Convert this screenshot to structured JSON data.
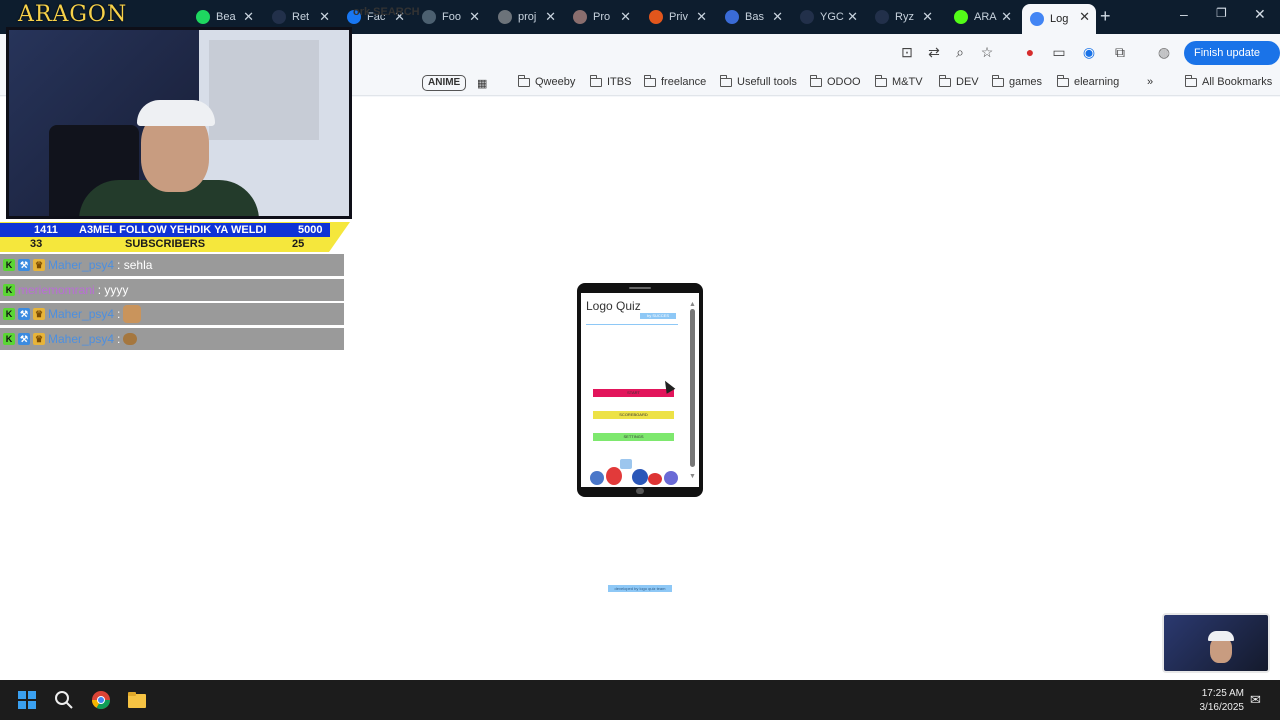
{
  "tabs": [
    {
      "label": "Bea",
      "icon": "spotify-icon",
      "color": "#1ed760"
    },
    {
      "label": "Ret",
      "icon": "page-icon",
      "color": "#22304a"
    },
    {
      "label": "Fac",
      "icon": "facebook-icon",
      "color": "#1877f2"
    },
    {
      "label": "Foo",
      "icon": "c-icon",
      "color": "#4c6070"
    },
    {
      "label": "proj",
      "icon": "dots-icon",
      "color": "#6c737a"
    },
    {
      "label": "Pro",
      "icon": "avatar-icon",
      "color": "#8a6e6e"
    },
    {
      "label": "Priv",
      "icon": "u-icon",
      "color": "#e2561c"
    },
    {
      "label": "Bas",
      "icon": "loader-icon",
      "color": "#3a6bd6"
    },
    {
      "label": "YGC",
      "icon": "page-icon",
      "color": "#22304a"
    },
    {
      "label": "Ryz",
      "icon": "page-icon",
      "color": "#22304a"
    },
    {
      "label": "ARA",
      "icon": "kick-icon",
      "color": "#53fc18"
    },
    {
      "label": "Log",
      "icon": "google-icon",
      "color": "#4285f4"
    }
  ],
  "toolbar": {
    "update_label": "Finish update"
  },
  "bookmarks": {
    "work_search": "ork SEARCH",
    "anime": "ANIME",
    "folders": [
      "Qweeby",
      "ITBS",
      "freelance",
      "Usefull tools",
      "ODOO",
      "M&TV",
      "DEV",
      "games",
      "elearning"
    ],
    "all_label": "All Bookmarks"
  },
  "overlay": {
    "brand": "ARAGON",
    "counter": {
      "left_top": "1411",
      "message": "A3MEL FOLLOW YEHDIK YA WELDI",
      "right_top": "5000",
      "left_bottom": "33",
      "subscribers": "SUBSCRIBERS",
      "right_bottom": "25"
    },
    "chat": [
      {
        "user": "Maher_psy4",
        "text": ": sehla",
        "badges": [
          "K",
          "W",
          "C"
        ],
        "emote": false,
        "pink": false
      },
      {
        "user": "meriemomrani",
        "text": ": yyyy",
        "badges": [
          "K"
        ],
        "emote": false,
        "pink": true
      },
      {
        "user": "Maher_psy4",
        "text": ":",
        "badges": [
          "K",
          "W",
          "C"
        ],
        "emote": "face",
        "pink": false
      },
      {
        "user": "Maher_psy4",
        "text": ":",
        "badges": [
          "K",
          "W",
          "C"
        ],
        "emote": "small",
        "pink": false
      }
    ]
  },
  "app": {
    "title": "Logo Quiz",
    "subtitle": "by SUCCES",
    "buttons": [
      {
        "label": "START",
        "color": "#e2155b"
      },
      {
        "label": "SCOREBOARD",
        "color": "#ede246"
      },
      {
        "label": "SETTINGS",
        "color": "#7ee86e"
      }
    ],
    "credit": "developed by logo quiz team"
  },
  "taskbar": {
    "time": "17:25 AM",
    "date": "3/16/2025"
  }
}
